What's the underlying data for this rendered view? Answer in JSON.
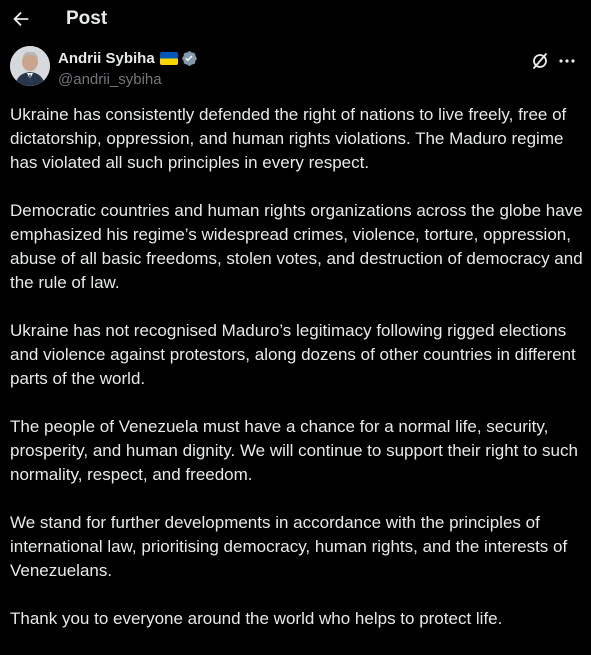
{
  "header": {
    "title": "Post",
    "back_icon": "arrow-left-icon"
  },
  "author": {
    "display_name": "Andrii Sybiha",
    "handle": "@andrii_sybiha",
    "verified": true,
    "flag": "ukraine-flag",
    "flag_colors": [
      "#0057B7",
      "#FFD700"
    ],
    "verified_color": "#829aab"
  },
  "actions": {
    "grok_icon": "grok-slash-icon",
    "more_icon": "more-horizontal-icon"
  },
  "post": {
    "paragraphs": [
      "Ukraine has consistently defended the right of nations to live freely, free of dictatorship, oppression, and human rights violations. The Maduro regime has violated all such principles in every respect.",
      "Democratic countries and human rights organizations across the globe have emphasized his regime’s widespread crimes, violence, torture, oppression, abuse of all basic freedoms, stolen votes, and destruction of democracy and the rule of law.",
      "Ukraine has not recognised Maduro’s legitimacy following rigged elections and violence against protestors, along dozens of other countries in different parts of the world.",
      "The people of Venezuela must have a chance for a normal life, security, prosperity, and human dignity. We will continue to support their right to such normality, respect, and freedom.",
      "We stand for further developments in accordance with the principles of international law, prioritising democracy, human rights, and the interests of Venezuelans.",
      "Thank you to everyone around the world who helps to protect life."
    ]
  },
  "colors": {
    "background": "#000000",
    "text": "#e7e9ea",
    "secondary_text": "#71767b"
  }
}
